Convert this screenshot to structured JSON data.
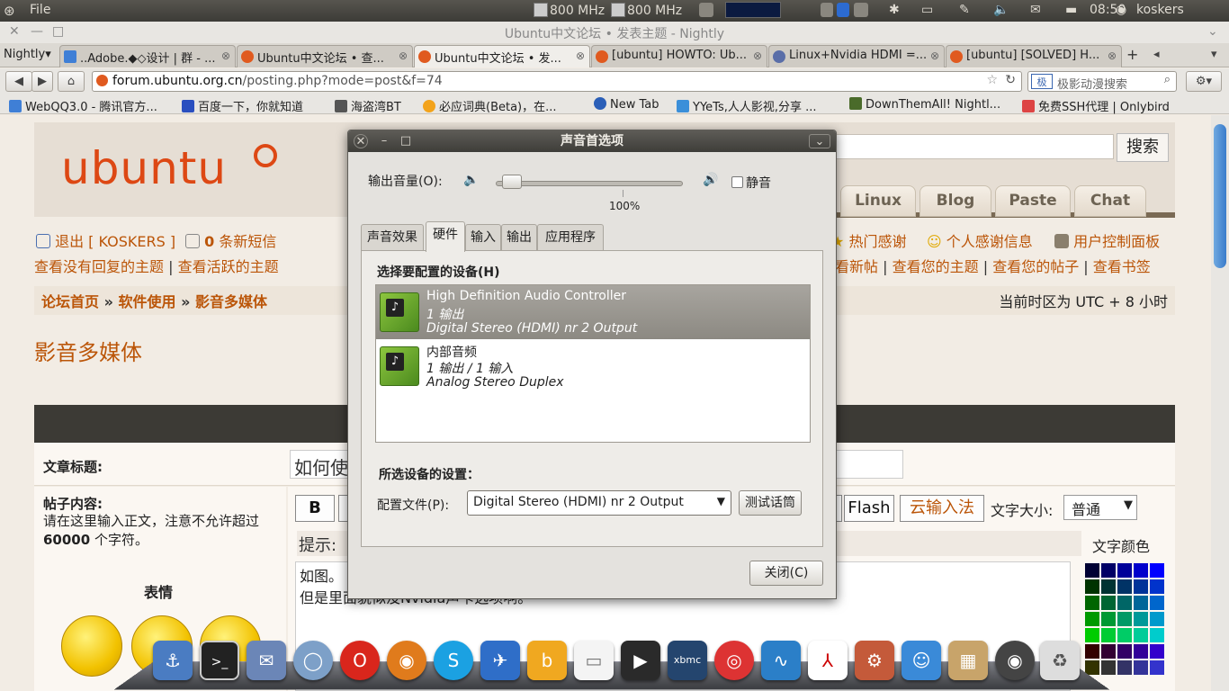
{
  "panel": {
    "app_menu": "File",
    "cpu1": "800 MHz",
    "cpu2": "800 MHz",
    "clock": "08:50",
    "user": "koskers"
  },
  "window_title": "Ubuntu中文论坛 • 发表主题 - Nightly",
  "browser": {
    "menu": "Nightly",
    "tabs": [
      {
        "label": "..Adobe.◆◇设计 | 群 - ..."
      },
      {
        "label": "Ubuntu中文论坛 • 查..."
      },
      {
        "label": "Ubuntu中文论坛 • 发..."
      },
      {
        "label": "[ubuntu] HOWTO: Ub..."
      },
      {
        "label": "Linux+Nvidia HDMI =..."
      },
      {
        "label": "[ubuntu] [SOLVED] H..."
      }
    ],
    "new_tab": "+",
    "url_host": "forum.ubuntu.org.cn",
    "url_path": "/posting.php?mode=post&f=74",
    "search_placeholder": "极影动漫搜索",
    "bookmarks": [
      {
        "label": "WebQQ3.0 - 腾讯官方..."
      },
      {
        "label": "百度一下，你就知道"
      },
      {
        "label": "海盗湾BT"
      },
      {
        "label": "必应词典(Beta)，在..."
      },
      {
        "label": "New Tab"
      },
      {
        "label": "YYeTs,人人影视,分享 ..."
      },
      {
        "label": "DownThemAll! Nightl..."
      },
      {
        "label": "免费SSH代理 | Onlybird"
      }
    ]
  },
  "site": {
    "logo": "ubuntu",
    "search_button": "搜索",
    "nav": [
      "Linux",
      "Blog",
      "Paste",
      "Chat"
    ],
    "logout": "退出 [ KOSKERS ]",
    "pm_count": "0",
    "pm_label": "条新短信",
    "thanks": "热门感谢",
    "my_thanks": "个人感谢信息",
    "ucp": "用户控制面板",
    "links_left": [
      "查看没有回复的主题",
      "查看活跃的主题"
    ],
    "links_right": [
      "看新帖",
      "查看您的主题",
      "查看您的帖子",
      "查看书签"
    ],
    "breadcrumb": [
      "论坛首页",
      "软件使用",
      "影音多媒体"
    ],
    "breadcrumb_sep": "»",
    "timezone": "当前时区为 UTC + 8 小时",
    "forum_title": "影音多媒体",
    "subject_label": "文章标题:",
    "subject_value": "如何使",
    "body_label": "帖子内容:",
    "body_desc_1": "请在这里输入正文，注意不允许超过 ",
    "body_desc_num": "60000",
    "body_desc_2": " 个字符。",
    "emoticons_label": "表情",
    "btn_bold": "B",
    "btn_flash": "Flash",
    "btn_ime": "云输入法",
    "font_size_label": "文字大小:",
    "font_size_value": "普通",
    "font_color_label": "文字颜色",
    "hint": "提示:",
    "editor_line1": "如图。",
    "editor_line2": "但是里面貌似没Nvidia声卡选项啊。"
  },
  "dialog": {
    "title": "声音首选项",
    "volume_label": "输出音量(O):",
    "volume_percent_label": "100%",
    "volume_level": 0.05,
    "mute_label": "静音",
    "tabs": [
      "声音效果",
      "硬件",
      "输入",
      "输出",
      "应用程序"
    ],
    "active_tab": "硬件",
    "choose_device_label": "选择要配置的设备(H)",
    "devices": [
      {
        "name": "High Definition Audio Controller",
        "io": "1 输出",
        "profile": "Digital Stereo (HDMI) nr 2 Output"
      },
      {
        "name": "内部音频",
        "io": "1 输出 / 1 输入",
        "profile": "Analog Stereo Duplex"
      }
    ],
    "settings_label": "所选设备的设置：",
    "profile_label": "配置文件(P):",
    "profile_value": "Digital Stereo (HDMI) nr 2 Output",
    "test_button": "测试话筒",
    "close_button": "关闭(C)"
  },
  "colors": {
    "ubuntu_orange": "#dd4814",
    "link": "#bb5508",
    "panel_dark": "#3c3b37"
  }
}
